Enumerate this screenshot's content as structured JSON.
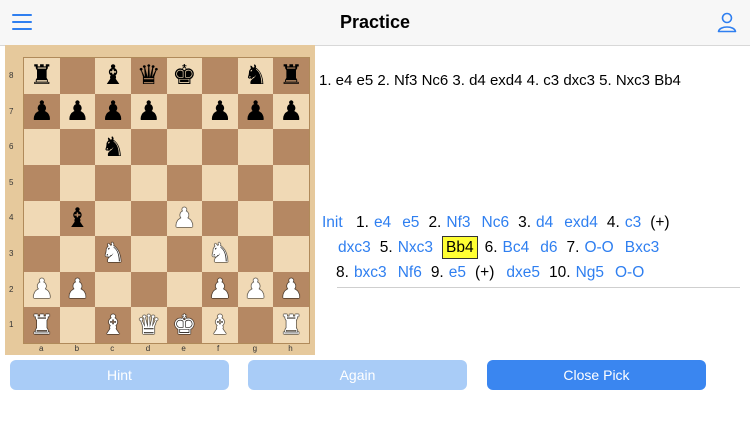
{
  "header": {
    "title": "Practice",
    "menu_icon": "hamburger-menu-icon",
    "user_icon": "person-icon",
    "accent": "#2f7ff0"
  },
  "board": {
    "files": [
      "a",
      "b",
      "c",
      "d",
      "e",
      "f",
      "g",
      "h"
    ],
    "ranks": [
      "8",
      "7",
      "6",
      "5",
      "4",
      "3",
      "2",
      "1"
    ],
    "rows": [
      [
        "r",
        "",
        "b",
        "q",
        "k",
        "",
        "n",
        "r"
      ],
      [
        "p",
        "p",
        "p",
        "p",
        "",
        "p",
        "p",
        "p"
      ],
      [
        "",
        "",
        "n",
        "",
        "",
        "",
        "",
        ""
      ],
      [
        "",
        "",
        "",
        "",
        "",
        "",
        "",
        ""
      ],
      [
        "",
        "b",
        "",
        "",
        "P",
        "",
        "",
        ""
      ],
      [
        "",
        "",
        "N",
        "",
        "",
        "N",
        "",
        ""
      ],
      [
        "P",
        "P",
        "",
        "",
        "",
        "P",
        "P",
        "P"
      ],
      [
        "R",
        "",
        "B",
        "Q",
        "K",
        "B",
        "",
        "R"
      ]
    ],
    "light_color": "#f0d9b5",
    "dark_color": "#b58863"
  },
  "opening_line": "1. e4 e5 2. Nf3 Nc6 3. d4 exd4 4. c3 dxc3 5. Nxc3 Bb4",
  "moves": {
    "init_label": "Init",
    "line1": [
      {
        "n": "1."
      },
      {
        "m": "e4"
      },
      {
        "m": "e5"
      },
      {
        "n": "2."
      },
      {
        "m": "Nf3"
      },
      {
        "m": "Nc6"
      },
      {
        "n": "3."
      },
      {
        "m": "d4"
      },
      {
        "m": "exd4"
      },
      {
        "n": "4."
      },
      {
        "m": "c3"
      },
      {
        "t": "(+)"
      }
    ],
    "line2": [
      {
        "m": "dxc3"
      },
      {
        "n": "5."
      },
      {
        "m": "Nxc3"
      },
      {
        "m": "Bb4",
        "current": true
      },
      {
        "n": "6."
      },
      {
        "m": "Bc4"
      },
      {
        "m": "d6"
      },
      {
        "n": "7."
      },
      {
        "m": "O-O"
      },
      {
        "m": "Bxc3"
      }
    ],
    "line3": [
      {
        "n": "8."
      },
      {
        "m": "bxc3"
      },
      {
        "m": "Nf6"
      },
      {
        "n": "9."
      },
      {
        "m": "e5"
      },
      {
        "t": "(+)"
      },
      {
        "m": "dxe5"
      },
      {
        "n": "10."
      },
      {
        "m": "Ng5"
      },
      {
        "m": "O-O"
      }
    ],
    "highlight_color": "#ffff33"
  },
  "buttons": {
    "hint": "Hint",
    "again": "Again",
    "close_pick": "Close Pick",
    "primary_color": "#3a86f0",
    "disabled_color": "#a9ccf7"
  }
}
